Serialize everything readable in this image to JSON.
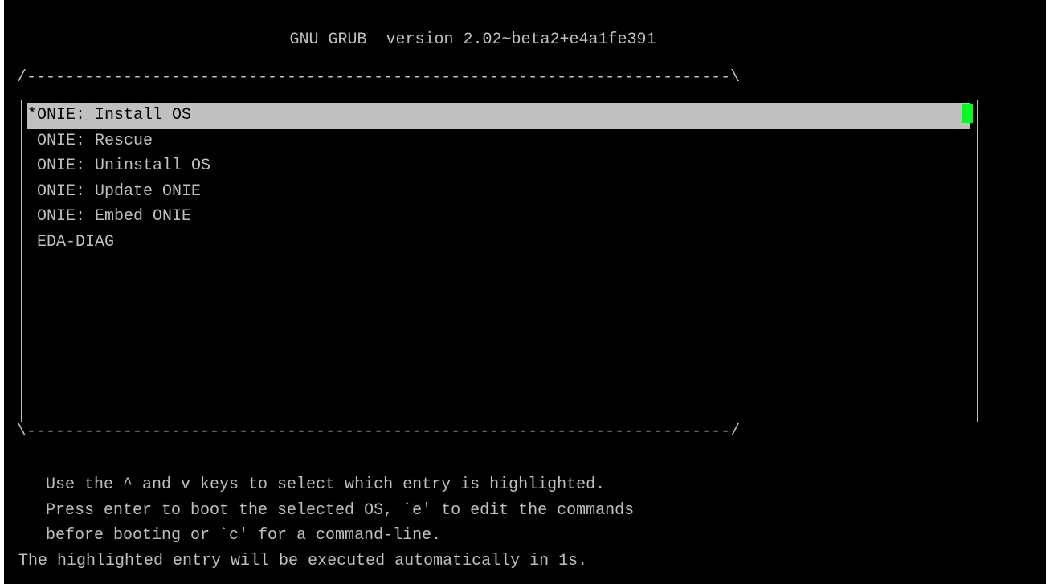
{
  "header": {
    "title": "GNU GRUB  version 2.02~beta2+e4a1fe391"
  },
  "frame": {
    "top": "/-------------------------------------------------------------------------\\",
    "bottom": "\\-------------------------------------------------------------------------/"
  },
  "menu": {
    "entries": [
      {
        "label": "*ONIE: Install OS",
        "selected": true
      },
      {
        "label": " ONIE: Rescue",
        "selected": false
      },
      {
        "label": " ONIE: Uninstall OS",
        "selected": false
      },
      {
        "label": " ONIE: Update ONIE",
        "selected": false
      },
      {
        "label": " ONIE: Embed ONIE",
        "selected": false
      },
      {
        "label": " EDA-DIAG",
        "selected": false
      }
    ],
    "highlight_color": "#c0c0c0",
    "scroll_color": "#00ff1e"
  },
  "help": {
    "line1": "Use the ^ and v keys to select which entry is highlighted.",
    "line2": "Press enter to boot the selected OS, `e' to edit the commands",
    "line3": "before booting or `c' for a command-line.",
    "countdown": "The highlighted entry will be executed automatically in 1s."
  }
}
